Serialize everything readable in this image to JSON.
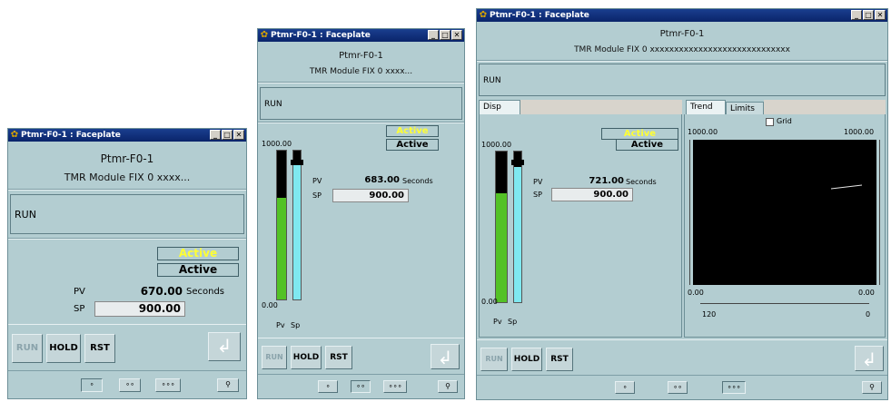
{
  "title": "Ptmr-F0-1 : Faceplate",
  "header": {
    "name": "Ptmr-F0-1",
    "desc_short": "TMR Module FIX 0 xxxx...",
    "desc_long": "TMR Module FIX 0 xxxxxxxxxxxxxxxxxxxxxxxxxxxxx"
  },
  "mode": "RUN",
  "status": {
    "alarm": "Active",
    "state": "Active"
  },
  "labels": {
    "pv": "PV",
    "sp": "SP",
    "units": "Seconds",
    "bar_pv": "Pv",
    "bar_sp": "Sp"
  },
  "scale": {
    "max": "1000.00",
    "min": "0.00"
  },
  "windows": [
    {
      "pv": "670.00",
      "sp": "900.00"
    },
    {
      "pv": "683.00",
      "sp": "900.00",
      "pv_fraction": 0.683,
      "sp_fraction": 0.9
    },
    {
      "pv": "721.00",
      "sp": "900.00",
      "pv_fraction": 0.721,
      "sp_fraction": 0.9
    }
  ],
  "buttons": {
    "run": "RUN",
    "hold": "HOLD",
    "rst": "RST",
    "enter_icon": "enter-arrow-icon"
  },
  "nav": {
    "b1": "∘",
    "b2": "∘∘",
    "b3": "∘∘∘",
    "pin_icon": "pin-icon"
  },
  "tabs": {
    "disp": "Disp",
    "trend": "Trend",
    "limits": "Limits"
  },
  "trend": {
    "grid_label": "Grid",
    "y_top_left": "1000.00",
    "y_top_right": "1000.00",
    "y_bottom_left": "0.00",
    "y_bottom_right": "0.00",
    "x_left": "120",
    "x_right": "0",
    "grid": false
  }
}
